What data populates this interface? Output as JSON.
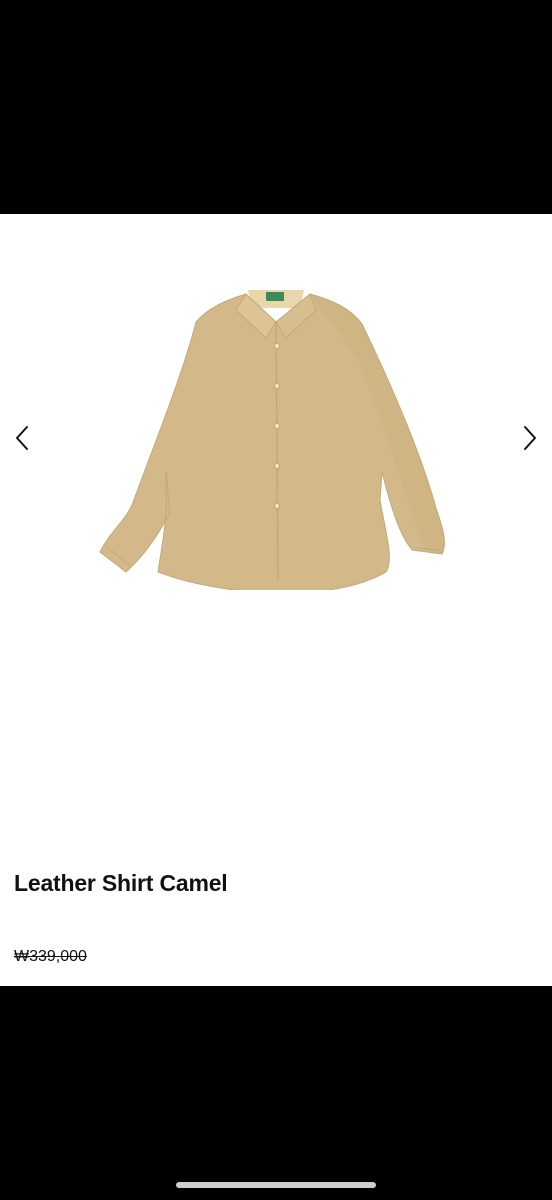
{
  "product": {
    "title": "Leather Shirt Camel",
    "price": "₩339,000",
    "image_alt": "camel leather shirt"
  },
  "carousel": {
    "prev_icon": "chevron-left-icon",
    "next_icon": "chevron-right-icon"
  },
  "colors": {
    "shirt": "#d3b98a",
    "background": "#ffffff",
    "frame": "#000000"
  }
}
